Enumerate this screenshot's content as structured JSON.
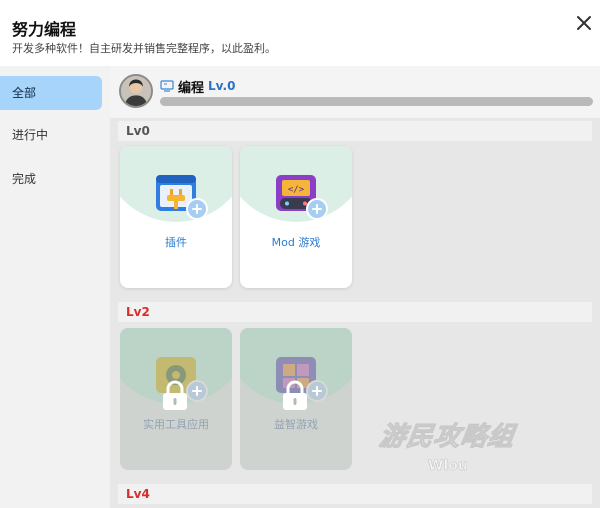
{
  "header": {
    "title": "努力编程",
    "subtitle": "开发多种软件！自主研发并销售完整程序，以此盈利。"
  },
  "sidebar": {
    "items": [
      {
        "label": "全部",
        "active": true
      },
      {
        "label": "进行中",
        "active": false
      },
      {
        "label": "完成",
        "active": false
      }
    ]
  },
  "profile": {
    "skill_name": "编程",
    "skill_level": "Lv.0",
    "progress": 0
  },
  "sections": [
    {
      "level": "Lv0",
      "locked": false,
      "cards": [
        {
          "label": "插件",
          "icon": "plugin-icon"
        },
        {
          "label": "Mod 游戏",
          "icon": "mod-game-icon"
        }
      ]
    },
    {
      "level": "Lv2",
      "locked": true,
      "cards": [
        {
          "label": "实用工具应用",
          "icon": "utility-app-icon"
        },
        {
          "label": "益智游戏",
          "icon": "puzzle-game-icon"
        }
      ]
    },
    {
      "level": "Lv4",
      "locked": true,
      "cards": []
    }
  ],
  "watermark": {
    "text": "游民攻略组",
    "sub": "Wlou"
  },
  "colors": {
    "accent": "#2b7bd0",
    "active_tab": "#a7d4fb",
    "locked_level": "#d62e2e",
    "card_arc": "#dcefe6"
  }
}
